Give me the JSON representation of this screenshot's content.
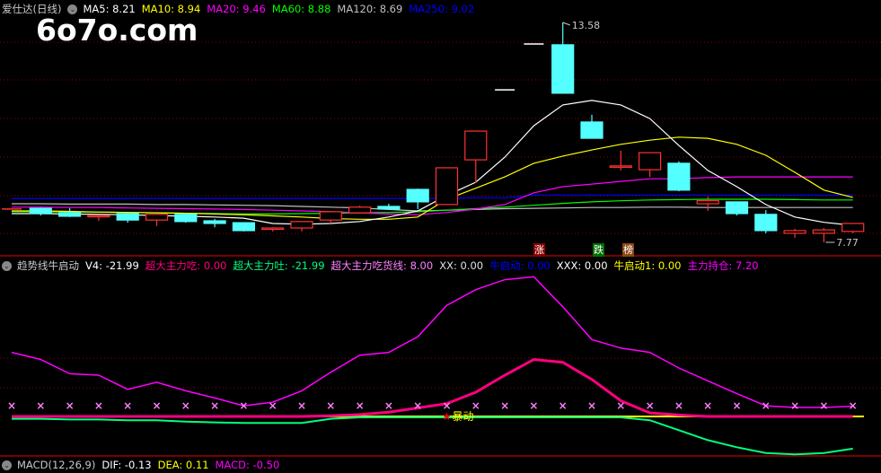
{
  "main_header": {
    "title": "爱仕达(日线)",
    "ma5": "MA5: 8.21",
    "ma10": "MA10: 8.94",
    "ma20": "MA20: 9.46",
    "ma60": "MA60: 8.88",
    "ma120": "MA120: 8.69",
    "ma250": "MA250: 9.02"
  },
  "logo": "6o7o.com",
  "price_labels": {
    "high": "13.58",
    "low": "7.77"
  },
  "tags": {
    "rise": "涨",
    "fall": "跌",
    "rank": "榜"
  },
  "indicator_header": {
    "title": "趋势线牛启动",
    "v4": "V4: -21.99",
    "eat": "超大主力吃: 0.00",
    "spit": "超大主力吐: -21.99",
    "eat_line": "超大主力吃货线: 8.00",
    "xx": "XX: 0.00",
    "bull_start": "牛启动: 0.00",
    "xxx": "XXX: 0.00",
    "bull_start1": "牛启动1: 0.00",
    "holding": "主力持仓: 7.20"
  },
  "signal_label": "暴动",
  "macd_header": {
    "title": "MACD(12,26,9)",
    "dif": "DIF: -0.13",
    "dea": "DEA: 0.11",
    "macd": "MACD: -0.50"
  },
  "colors": {
    "up": "#ff3232",
    "down": "#54ffff",
    "ma5": "#ffffff",
    "ma10": "#ffff00",
    "ma20": "#ff00ff",
    "ma60": "#00ff00",
    "ma120": "#c0c0c0",
    "ma250": "#0000ff",
    "grid": "#8b0000"
  },
  "chart_data": {
    "type": "candlestick",
    "price_range": [
      7.77,
      13.58
    ],
    "candles_ohlc": [
      [
        8.65,
        8.65,
        8.65,
        8.65
      ],
      [
        8.67,
        8.69,
        8.48,
        8.53
      ],
      [
        8.55,
        8.67,
        8.44,
        8.46
      ],
      [
        8.46,
        8.48,
        8.34,
        8.48
      ],
      [
        8.53,
        8.55,
        8.29,
        8.36
      ],
      [
        8.36,
        8.51,
        8.2,
        8.51
      ],
      [
        8.51,
        8.55,
        8.29,
        8.32
      ],
      [
        8.34,
        8.39,
        8.17,
        8.27
      ],
      [
        8.29,
        8.29,
        8.06,
        8.08
      ],
      [
        8.13,
        8.17,
        8.06,
        8.15
      ],
      [
        8.15,
        8.32,
        8.06,
        8.32
      ],
      [
        8.36,
        8.58,
        8.27,
        8.58
      ],
      [
        8.55,
        8.74,
        8.55,
        8.7
      ],
      [
        8.72,
        8.79,
        8.65,
        8.65
      ],
      [
        9.17,
        9.19,
        8.65,
        8.84
      ],
      [
        8.77,
        9.74,
        8.77,
        9.74
      ],
      [
        9.95,
        10.71,
        9.34,
        10.71
      ],
      [
        11.8,
        11.8,
        11.8,
        11.8
      ],
      [
        13.01,
        13.01,
        13.01,
        13.01
      ],
      [
        12.99,
        13.58,
        11.71,
        11.71
      ],
      [
        10.95,
        11.14,
        10.52,
        10.52
      ],
      [
        9.79,
        10.19,
        9.67,
        9.79
      ],
      [
        9.69,
        10.14,
        9.5,
        10.14
      ],
      [
        9.86,
        9.91,
        9.12,
        9.15
      ],
      [
        8.79,
        8.98,
        8.6,
        8.87
      ],
      [
        8.84,
        8.84,
        8.48,
        8.53
      ],
      [
        8.51,
        8.62,
        8.01,
        8.08
      ],
      [
        8.01,
        8.13,
        7.89,
        8.08
      ],
      [
        8.01,
        8.15,
        7.77,
        8.1
      ],
      [
        8.06,
        8.27,
        8.01,
        8.27
      ]
    ],
    "ma": {
      "ma5": [
        8.53,
        8.53,
        8.52,
        8.51,
        8.5,
        8.48,
        8.46,
        8.44,
        8.41,
        8.27,
        8.25,
        8.27,
        8.32,
        8.44,
        8.6,
        9.01,
        9.36,
        10.02,
        10.85,
        11.4,
        11.52,
        11.4,
        11.04,
        10.33,
        9.67,
        9.24,
        8.77,
        8.44,
        8.3,
        8.22
      ],
      "ma10": [
        8.6,
        8.6,
        8.59,
        8.57,
        8.56,
        8.55,
        8.54,
        8.52,
        8.5,
        8.47,
        8.44,
        8.4,
        8.38,
        8.38,
        8.44,
        8.91,
        9.2,
        9.5,
        9.86,
        10.05,
        10.21,
        10.36,
        10.47,
        10.55,
        10.52,
        10.36,
        10.07,
        9.62,
        9.15,
        8.96
      ],
      "ma20": [
        8.7,
        8.7,
        8.69,
        8.69,
        8.68,
        8.67,
        8.66,
        8.65,
        8.64,
        8.62,
        8.6,
        8.58,
        8.55,
        8.52,
        8.5,
        8.56,
        8.65,
        8.77,
        9.08,
        9.24,
        9.31,
        9.38,
        9.45,
        9.45,
        9.48,
        9.5,
        9.5,
        9.5,
        9.5,
        9.5
      ],
      "ma60": [
        8.58,
        8.58,
        8.57,
        8.57,
        8.56,
        8.55,
        8.54,
        8.53,
        8.52,
        8.52,
        8.53,
        8.54,
        8.55,
        8.56,
        8.58,
        8.62,
        8.66,
        8.7,
        8.75,
        8.8,
        8.84,
        8.87,
        8.89,
        8.9,
        8.91,
        8.91,
        8.91,
        8.9,
        8.89,
        8.89
      ],
      "ma120": [
        8.79,
        8.79,
        8.78,
        8.78,
        8.78,
        8.77,
        8.77,
        8.76,
        8.75,
        8.74,
        8.72,
        8.7,
        8.68,
        8.64,
        8.6,
        8.62,
        8.64,
        8.66,
        8.67,
        8.68,
        8.69,
        8.69,
        8.7,
        8.7,
        8.69,
        8.69,
        8.69,
        8.69,
        8.69,
        8.69
      ],
      "ma250": [
        8.93,
        8.93,
        8.93,
        8.93,
        8.93,
        8.93,
        8.93,
        8.93,
        8.93,
        8.93,
        8.93,
        8.93,
        8.93,
        8.93,
        8.93,
        8.93,
        8.95,
        8.95,
        9.02,
        9.02,
        9.02,
        9.02,
        9.02,
        9.02,
        9.02,
        9.02,
        9.02,
        9.02,
        9.02,
        9.02
      ]
    },
    "indicator": {
      "holding": [
        45,
        40,
        30,
        29,
        19,
        24,
        18,
        13,
        7.5,
        10,
        18,
        31,
        43,
        45,
        56,
        78,
        89,
        96,
        98,
        77,
        54,
        48,
        45,
        34,
        25,
        16,
        7.5,
        6.3,
        6.3,
        7.2
      ],
      "eat": [
        0,
        0,
        0,
        0,
        0,
        0,
        0,
        0,
        0,
        0,
        0,
        0.5,
        1.3,
        3,
        6,
        9,
        17,
        29,
        40,
        38,
        26,
        11,
        2.5,
        1,
        0,
        0,
        0,
        0,
        0,
        0
      ],
      "spit": [
        -1,
        -1,
        -1.5,
        -1.5,
        -2,
        -2,
        -3,
        -3.5,
        -4,
        -4,
        -4,
        -1,
        0,
        0,
        0,
        0,
        0,
        0,
        0,
        0,
        0,
        0,
        -2,
        -9,
        -16,
        -21,
        -25,
        -26,
        -25,
        -21.99
      ],
      "baseline": 0,
      "markers_level": 7.5,
      "signal_index": 15
    }
  }
}
